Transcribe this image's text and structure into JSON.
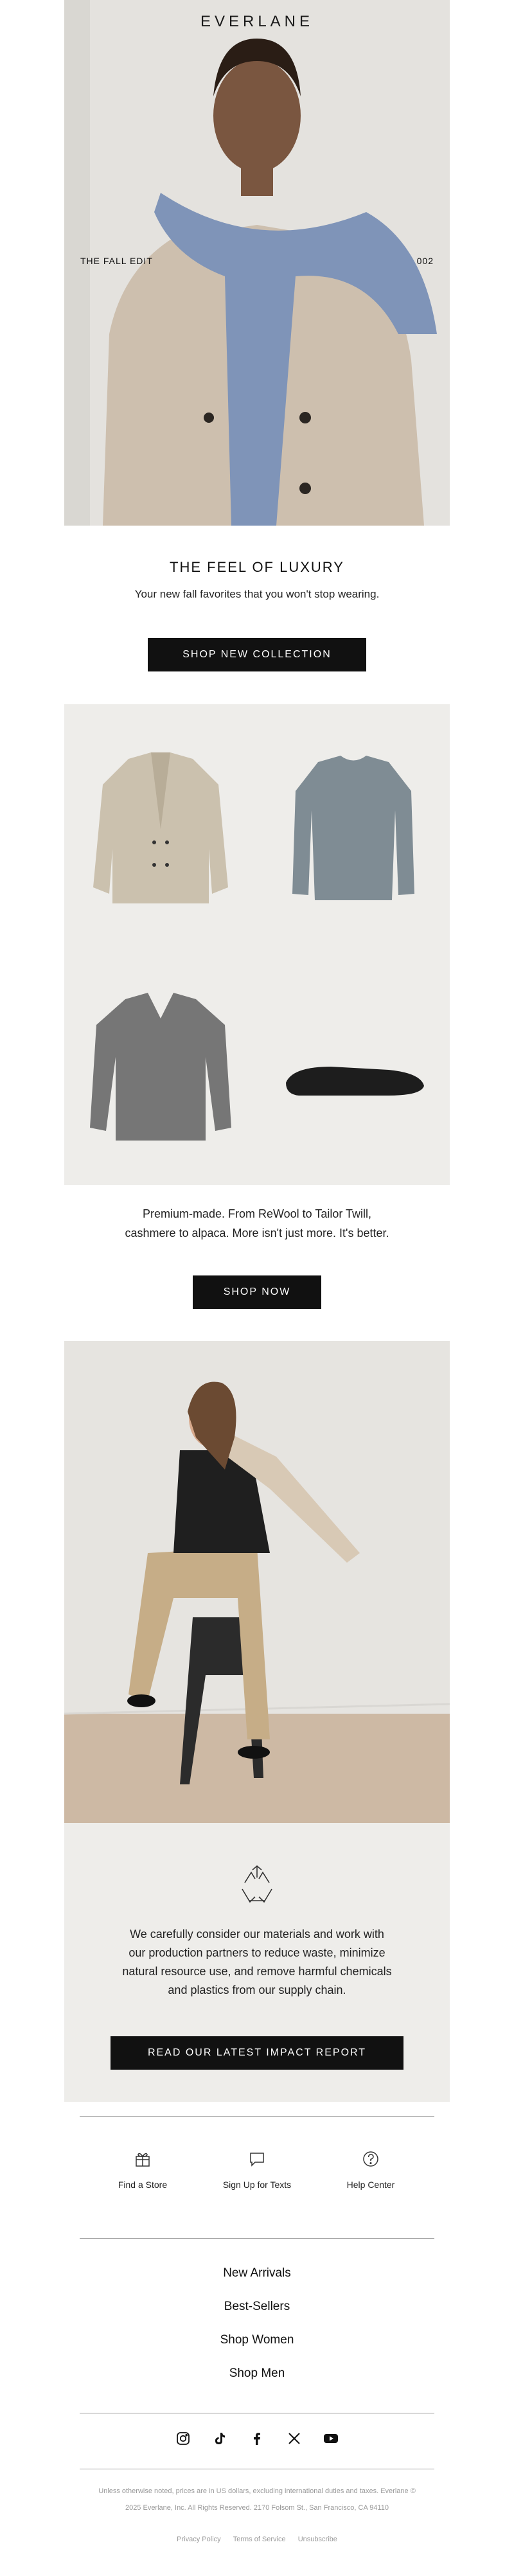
{
  "brand": "EVERLANE",
  "hero": {
    "left_label": "THE FALL EDIT",
    "right_label": "002"
  },
  "intro": {
    "title": "THE FEEL OF LUXURY",
    "subtitle": "Your new fall favorites that you won't stop wearing.",
    "button": "SHOP NEW COLLECTION"
  },
  "products": {
    "copy_line1": "Premium-made. From ReWool to Tailor Twill,",
    "copy_line2": "cashmere to alpaca. More isn't just more. It's better.",
    "button": "SHOP NOW"
  },
  "impact": {
    "icon": "recycle-icon",
    "line1": "We carefully consider our materials and work with",
    "line2": "our production partners to reduce waste, minimize",
    "line3": "natural resource use, and remove harmful chemicals",
    "line4": "and plastics from our supply chain.",
    "button": "READ OUR LATEST IMPACT REPORT"
  },
  "utilities": [
    {
      "icon": "gift-icon",
      "label": "Find a Store"
    },
    {
      "icon": "chat-icon",
      "label": "Sign Up for Texts"
    },
    {
      "icon": "help-icon",
      "label": "Help Center"
    }
  ],
  "nav": [
    "New Arrivals",
    "Best-Sellers",
    "Shop Women",
    "Shop Men"
  ],
  "social": [
    "instagram-icon",
    "tiktok-icon",
    "facebook-icon",
    "x-icon",
    "youtube-icon"
  ],
  "legal": {
    "line1": "Unless otherwise noted, prices are in US dollars, excluding international duties and taxes. Everlane ©",
    "line2": "2025 Everlane, Inc. All Rights Reserved. 2170 Folsom St., San Francisco, CA 94110"
  },
  "footer_links": [
    "Privacy Policy",
    "Terms of Service",
    "Unsubscribe"
  ]
}
